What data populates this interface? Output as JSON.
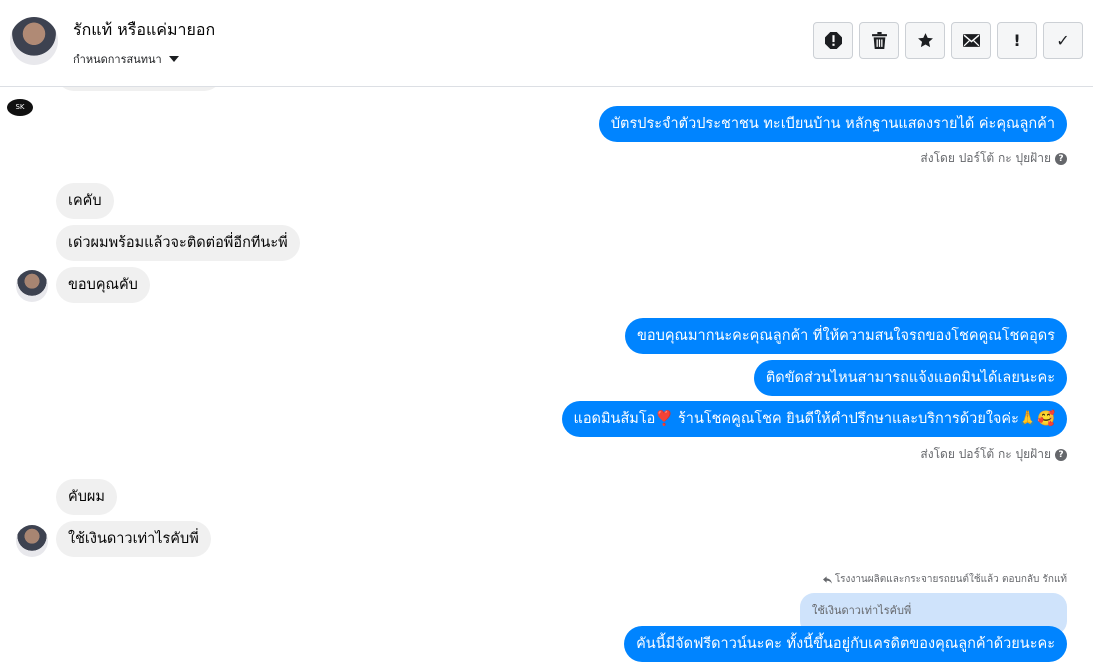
{
  "header": {
    "contact_name": "รักแท้ หรือแค่มายอก",
    "conversation_settings": "กำหนดการสนทนา",
    "toolbar": [
      {
        "icon": "spam-icon"
      },
      {
        "icon": "trash-icon"
      },
      {
        "icon": "star-icon"
      },
      {
        "icon": "envelope-icon"
      },
      {
        "icon": "important-icon",
        "label": "!"
      },
      {
        "icon": "checkmark-icon",
        "label": "✓"
      }
    ]
  },
  "messages": {
    "out_1": "บัตรประจำตัวประชาชน ทะเบียนบ้าน หลักฐานแสดงรายได้ ค่ะคุณลูกค้า",
    "sent_by_1": "ส่งโดย ปอร์โต้ กะ ปุยฝ้าย",
    "in_1": "เคคับ",
    "in_2": "เด่วผมพร้อมแล้วจะติดต่อพี่อีกทีนะพี่",
    "in_3": "ขอบคุณคับ",
    "out_2": "ขอบคุณมากนะคะคุณลูกค้า ที่ให้ความสนใจรถของโชคคูณโชคอุดร",
    "out_3": "ติดขัดส่วนไหนสามารถแจ้งแอดมินได้เลยนะคะ",
    "out_4": "แอดมินส้มโอ❣️ ร้านโชคคูณโชค ยินดีให้คำปรึกษาและบริการด้วยใจค่ะ🙏🥰",
    "sent_by_2": "ส่งโดย ปอร์โต้ กะ ปุยฝ้าย",
    "in_4": "คับผม",
    "in_5": "ใช้เงินดาวเท่าไรคับพี่",
    "reply_note": "โรงงานผลิตและกระจายรถยนต์ใช้แล้ว ตอบกลับ รักแท้",
    "quoted": "ใช้เงินดาวเท่าไรคับพี่",
    "out_5": "คันนี้มีจัดฟรีดาวน์นะคะ ทั้งนี้ขึ้นอยู่กับเครดิตของคุณลูกค้าด้วยนะคะ"
  },
  "page_logo_text": "SK",
  "help_icon_glyph": "?",
  "colors": {
    "outgoing_bubble": "#0084ff",
    "incoming_bubble": "#f0f0f0",
    "quoted_bubble": "#cfe3fb"
  }
}
